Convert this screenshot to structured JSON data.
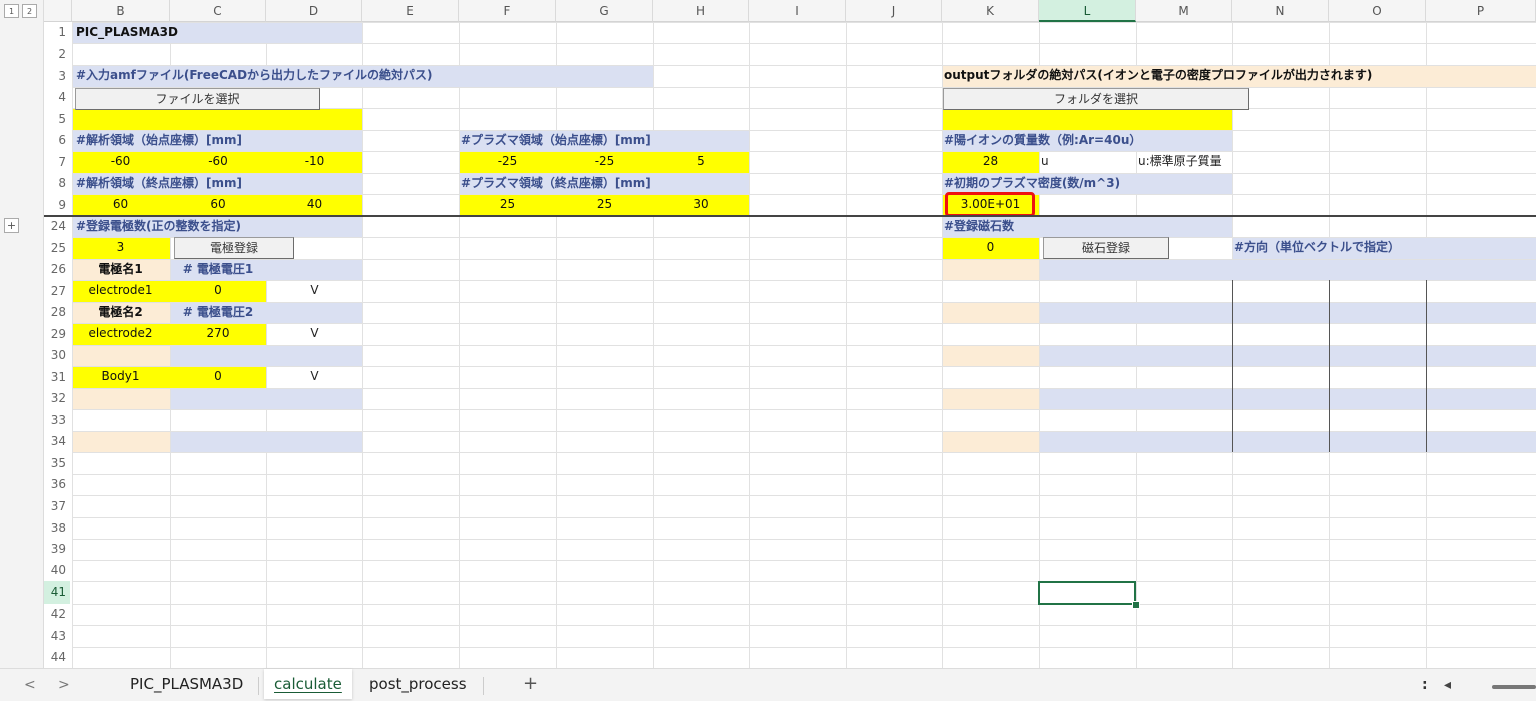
{
  "outline_buttons": [
    "1",
    "2"
  ],
  "columns": [
    "B",
    "C",
    "D",
    "E",
    "F",
    "G",
    "H",
    "I",
    "J",
    "K",
    "L",
    "M",
    "N",
    "O",
    "P"
  ],
  "rows": [
    "1",
    "2",
    "3",
    "4",
    "5",
    "6",
    "7",
    "8",
    "9",
    "24",
    "25",
    "26",
    "27",
    "28",
    "29",
    "30",
    "31",
    "32",
    "33",
    "34",
    "35",
    "36",
    "37",
    "38",
    "39",
    "40",
    "41",
    "42",
    "43",
    "44"
  ],
  "expand_button": "+",
  "colors": {
    "yellow": "#ffff00",
    "blue": "#dae0f2",
    "peach": "#fcecd6",
    "header_text": "#3b4f8c",
    "accent": "#217346",
    "highlight": "#e11111"
  },
  "labels": {
    "title": "PIC_PLASMA3D",
    "input_amf": "#入力amfファイル(FreeCADから出力したファイルの絶対パス)",
    "analysis_start": "#解析領域（始点座標）[mm]",
    "analysis_end": "#解析領域（終点座標）[mm]",
    "plasma_start": "#プラズマ領域（始点座標）[mm]",
    "plasma_end": "#プラズマ領域（終点座標）[mm]",
    "output_folder": "outputフォルダの絶対パス(イオンと電子の密度プロファイルが出力されます)",
    "ion_mass": "#陽イオンの質量数（例:Ar=40u）",
    "initial_density": "#初期のプラズマ密度(数/m^3)",
    "electrode_count": "#登録電極数(正の整数を指定)",
    "magnet_count": "#登録磁石数",
    "direction": "#方向（単位ベクトルで指定）",
    "electrode_name1": "電極名1",
    "electrode_voltage1": "# 電極電圧1",
    "electrode_name2": "電極名2",
    "electrode_voltage2": "# 電極電圧2",
    "unit_u": "u",
    "unit_u_note": "u:標準原子質量",
    "unit_v": "V"
  },
  "buttons": {
    "select_file": "ファイルを選択",
    "select_folder": "フォルダを選択",
    "register_electrode": "電極登録",
    "register_magnet": "磁石登録"
  },
  "values": {
    "analysis_start": [
      "-60",
      "-60",
      "-10"
    ],
    "analysis_end": [
      "60",
      "60",
      "40"
    ],
    "plasma_start": [
      "-25",
      "-25",
      "5"
    ],
    "plasma_end": [
      "25",
      "25",
      "30"
    ],
    "ion_mass": "28",
    "initial_density": "3.00E+01",
    "electrode_count": "3",
    "magnet_count": "0",
    "electrodes": [
      {
        "name": "electrode1",
        "voltage": "0"
      },
      {
        "name": "electrode2",
        "voltage": "270"
      },
      {
        "name": "Body1",
        "voltage": "0"
      }
    ]
  },
  "sheet_tabs": [
    "PIC_PLASMA3D",
    "calculate",
    "post_process"
  ],
  "active_tab": "calculate",
  "add_sheet": "+",
  "nav_prev": "<",
  "nav_next": ">",
  "more_menu": ":",
  "scroll_left": "◂"
}
